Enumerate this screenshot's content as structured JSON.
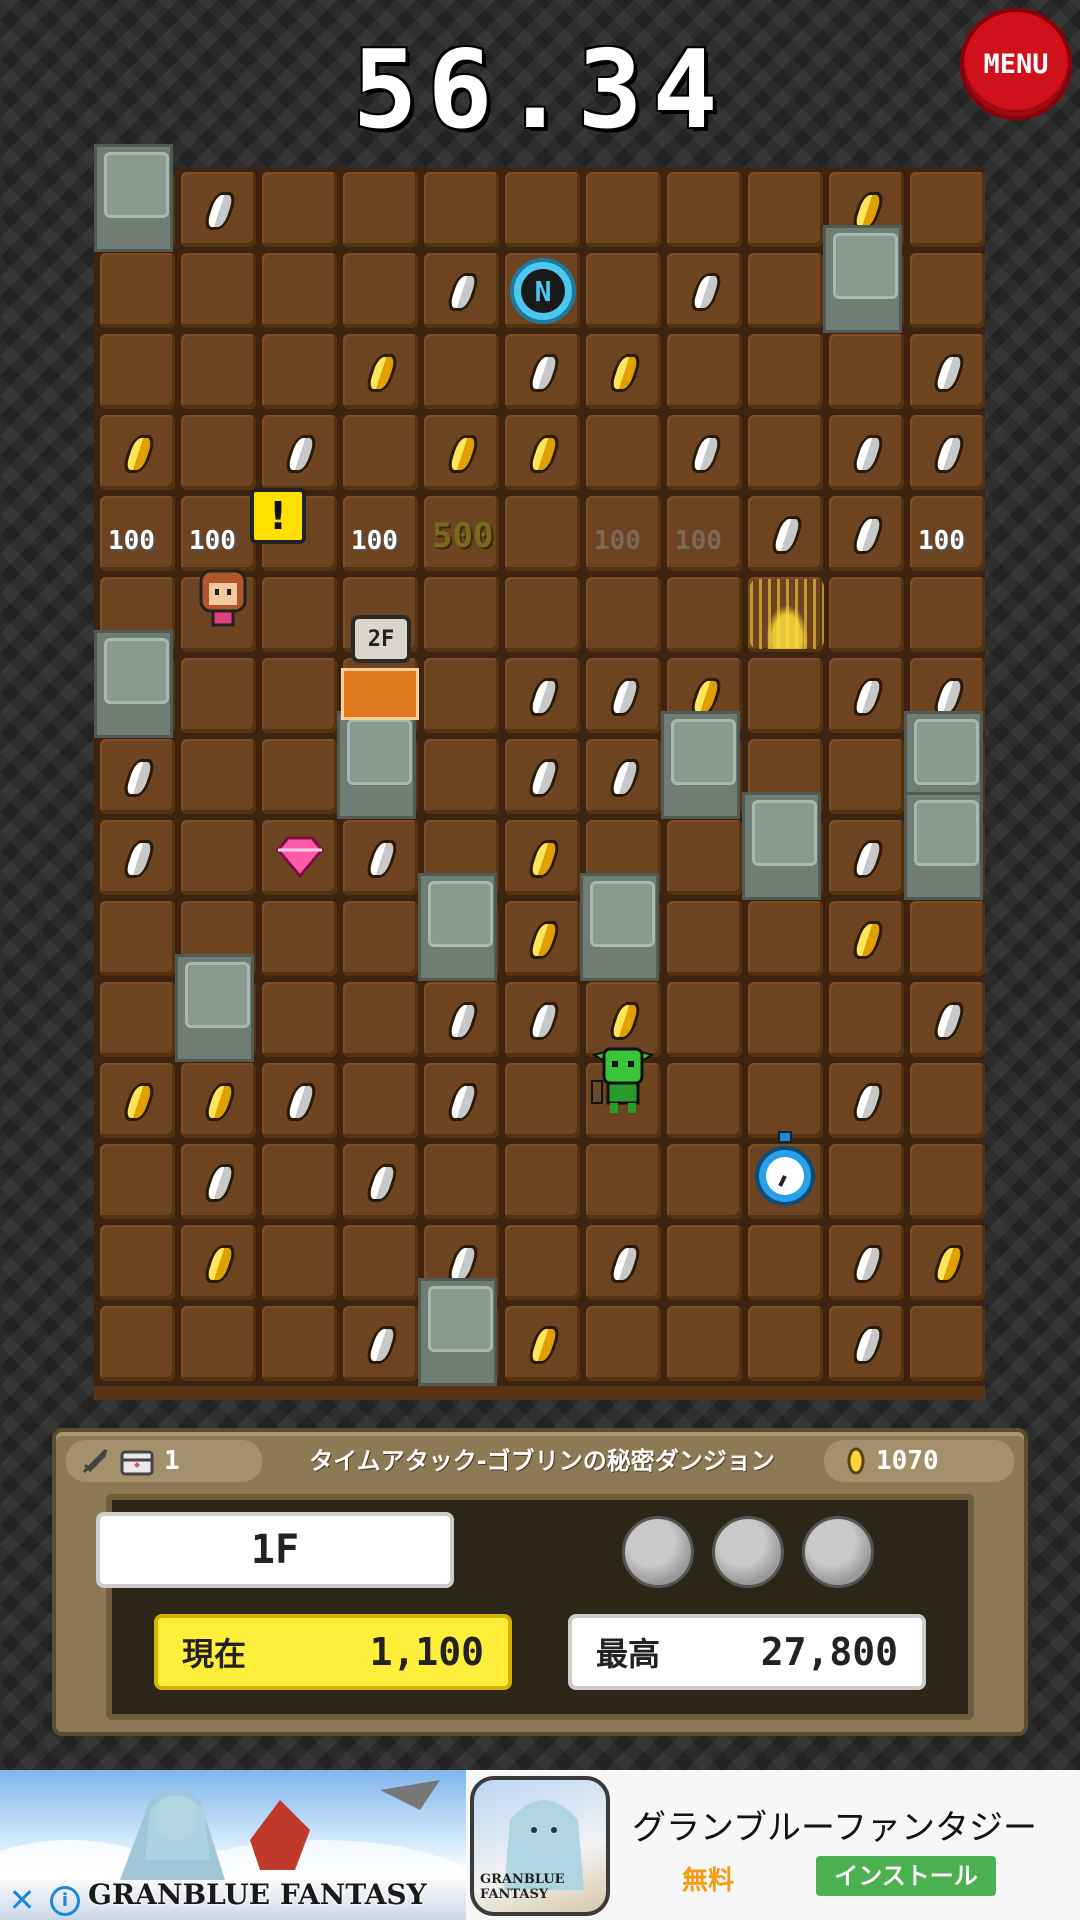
{
  "timer": "56.34",
  "menu_label": "MENU",
  "board": {
    "columns": 11,
    "rows": 15,
    "blocks": [
      [
        0,
        0
      ],
      [
        9,
        1
      ],
      [
        0,
        6
      ],
      [
        3,
        7
      ],
      [
        10,
        7
      ],
      [
        7,
        7
      ],
      [
        8,
        8
      ],
      [
        10,
        8
      ],
      [
        4,
        9
      ],
      [
        6,
        9
      ],
      [
        1,
        10
      ],
      [
        4,
        14
      ]
    ],
    "coins": [
      {
        "c": 1,
        "r": 0,
        "t": "silver"
      },
      {
        "c": 9,
        "r": 0,
        "t": "gold"
      },
      {
        "c": 4,
        "r": 1,
        "t": "silver"
      },
      {
        "c": 7,
        "r": 1,
        "t": "silver"
      },
      {
        "c": 3,
        "r": 2,
        "t": "gold"
      },
      {
        "c": 5,
        "r": 2,
        "t": "silver"
      },
      {
        "c": 6,
        "r": 2,
        "t": "gold"
      },
      {
        "c": 10,
        "r": 2,
        "t": "silver"
      },
      {
        "c": 0,
        "r": 3,
        "t": "gold"
      },
      {
        "c": 2,
        "r": 3,
        "t": "silver"
      },
      {
        "c": 4,
        "r": 3,
        "t": "gold"
      },
      {
        "c": 5,
        "r": 3,
        "t": "gold"
      },
      {
        "c": 7,
        "r": 3,
        "t": "silver"
      },
      {
        "c": 9,
        "r": 3,
        "t": "silver"
      },
      {
        "c": 10,
        "r": 3,
        "t": "silver"
      },
      {
        "c": 8,
        "r": 4,
        "t": "silver"
      },
      {
        "c": 9,
        "r": 4,
        "t": "silver"
      },
      {
        "c": 5,
        "r": 6,
        "t": "silver"
      },
      {
        "c": 6,
        "r": 6,
        "t": "silver"
      },
      {
        "c": 7,
        "r": 6,
        "t": "gold"
      },
      {
        "c": 9,
        "r": 6,
        "t": "silver"
      },
      {
        "c": 10,
        "r": 6,
        "t": "silver"
      },
      {
        "c": 0,
        "r": 7,
        "t": "silver"
      },
      {
        "c": 5,
        "r": 7,
        "t": "silver"
      },
      {
        "c": 6,
        "r": 7,
        "t": "silver"
      },
      {
        "c": 0,
        "r": 8,
        "t": "silver"
      },
      {
        "c": 3,
        "r": 8,
        "t": "silver"
      },
      {
        "c": 5,
        "r": 8,
        "t": "gold"
      },
      {
        "c": 9,
        "r": 8,
        "t": "silver"
      },
      {
        "c": 5,
        "r": 9,
        "t": "gold"
      },
      {
        "c": 9,
        "r": 9,
        "t": "gold"
      },
      {
        "c": 4,
        "r": 10,
        "t": "silver"
      },
      {
        "c": 5,
        "r": 10,
        "t": "silver"
      },
      {
        "c": 6,
        "r": 10,
        "t": "gold"
      },
      {
        "c": 10,
        "r": 10,
        "t": "silver"
      },
      {
        "c": 0,
        "r": 11,
        "t": "gold"
      },
      {
        "c": 1,
        "r": 11,
        "t": "gold"
      },
      {
        "c": 2,
        "r": 11,
        "t": "silver"
      },
      {
        "c": 4,
        "r": 11,
        "t": "silver"
      },
      {
        "c": 9,
        "r": 11,
        "t": "silver"
      },
      {
        "c": 1,
        "r": 12,
        "t": "silver"
      },
      {
        "c": 3,
        "r": 12,
        "t": "silver"
      },
      {
        "c": 1,
        "r": 13,
        "t": "gold"
      },
      {
        "c": 4,
        "r": 13,
        "t": "silver"
      },
      {
        "c": 6,
        "r": 13,
        "t": "silver"
      },
      {
        "c": 9,
        "r": 13,
        "t": "silver"
      },
      {
        "c": 10,
        "r": 13,
        "t": "gold"
      },
      {
        "c": 3,
        "r": 14,
        "t": "silver"
      },
      {
        "c": 5,
        "r": 14,
        "t": "gold"
      },
      {
        "c": 9,
        "r": 14,
        "t": "silver"
      }
    ],
    "point_popups": [
      {
        "c": 0,
        "r": 4,
        "text": "100",
        "style": "normal"
      },
      {
        "c": 1,
        "r": 4,
        "text": "100",
        "style": "normal"
      },
      {
        "c": 3,
        "r": 4,
        "text": "100",
        "style": "normal"
      },
      {
        "c": 4,
        "r": 4,
        "text": "500",
        "style": "big"
      },
      {
        "c": 6,
        "r": 4,
        "text": "100",
        "style": "faded"
      },
      {
        "c": 7,
        "r": 4,
        "text": "100",
        "style": "faded"
      },
      {
        "c": 10,
        "r": 4,
        "text": "100",
        "style": "normal"
      }
    ],
    "stairs_label": "2F",
    "alert_mark": "!",
    "compass_label": "N",
    "compass_icon": "compass-icon",
    "hero_icon": "hero-icon",
    "goblin_icon": "goblin-icon",
    "stopwatch_icon": "stopwatch-icon",
    "gem_icon": "pink-gem-icon",
    "sparkle_icon": "warp-sparkle-icon",
    "colors": {
      "tile": "#6e4320",
      "block": "#8a9a90",
      "gold": "#ffe55a",
      "silver": "#ffffff"
    }
  },
  "hud": {
    "weapon_icon": "sword-icon",
    "item_icon": "treasure-chest-icon",
    "item_count": "1",
    "title": "タイムアタック-ゴブリンの秘密ダンジョン",
    "coin_icon": "gold-coin-icon",
    "coins": "1070",
    "floor": "1F",
    "orbs": 3,
    "current_label": "現在",
    "current_score": "1,100",
    "best_label": "最高",
    "best_score": "27,800"
  },
  "ad": {
    "art_logo": "GRANBLUE FANTASY",
    "icon_logo": "GRANBLUE FANTASY",
    "title": "グランブルーファンタジー",
    "price": "無料",
    "install_label": "インストール",
    "close_symbol": "✕",
    "info_symbol": "i"
  }
}
